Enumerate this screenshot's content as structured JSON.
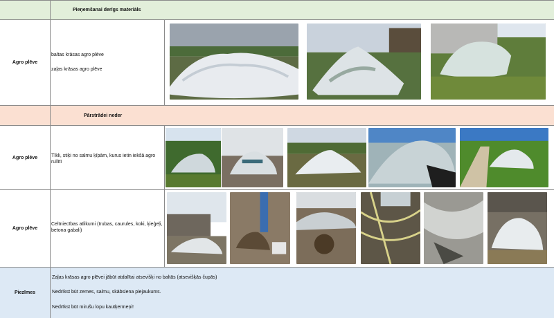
{
  "sections": {
    "acceptable_header": "Pieņemšanai derīgs materiāls",
    "not_recyclable_header": "Pārstrādei neder"
  },
  "rows": {
    "acceptable": {
      "label": "Agro plēve",
      "items": [
        "baltas krāsas agro plēve",
        "zaļas krāsas agro plēve"
      ]
    },
    "not_nets": {
      "label": "Agro plēve",
      "text": "Tīkli, stiķi no salmu ķīpām, kurus ietin iekšā agro rullītī"
    },
    "not_construction": {
      "label": "Agro plēve",
      "text": "Celtniecības atlikumi (trubas, caurules, koki, ķieģeļi, betona gabali)"
    },
    "notes": {
      "label": "Piezīmes",
      "lines": [
        "Zaļas krāsas agro plēvei jābūt atdalītai atsevišķi no baltās (atsevišķās čupās)",
        "Nedrīkst būt zemes, salmu, skābsiena piejaukums.",
        "Nedrīkst būt mirušu lopu kautķermeņi!"
      ]
    }
  },
  "colors": {
    "header_green": "#e2efda",
    "header_salmon": "#fbe0d2",
    "notes_blue": "#dde9f5",
    "grid_line": "#8a8a8a"
  },
  "photos": {
    "acceptable": [
      "white-film-pile-field-photo",
      "white-film-pile-barn-photo",
      "white-film-grass-wall-photo"
    ],
    "nets": [
      "film-pile-trees-photo",
      "film-pile-ground-photo",
      "film-pile-field-photo",
      "netting-pile-photo",
      "film-pile-road-photo"
    ],
    "construction": [
      "debris-film-shed-photo",
      "construction-waste-pile-photo",
      "debris-mixed-photo",
      "netting-twine-photo",
      "dirty-film-closeup-photo",
      "film-by-wall-photo"
    ]
  }
}
